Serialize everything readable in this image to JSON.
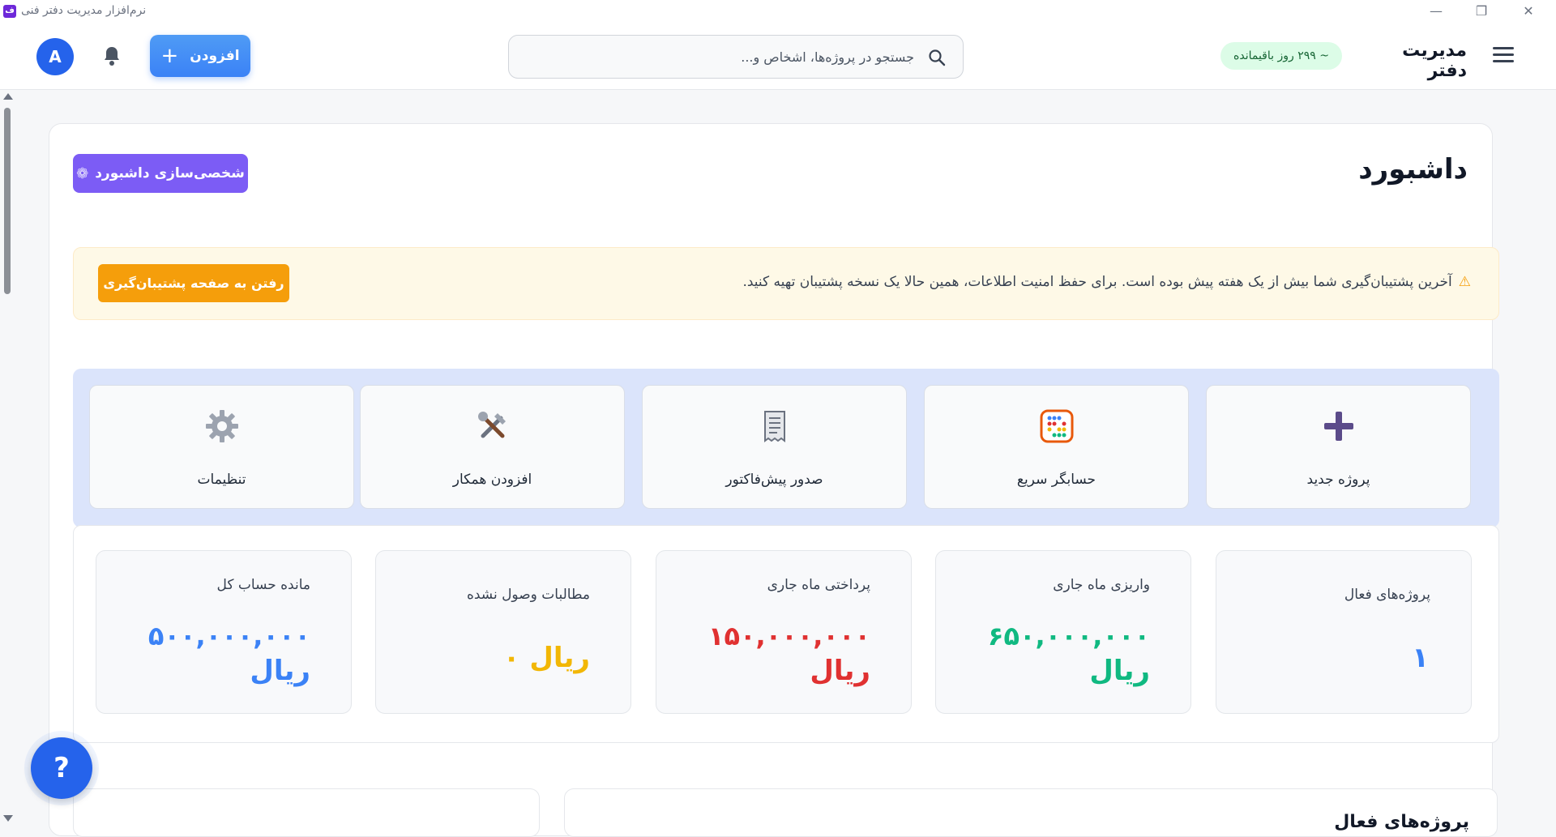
{
  "window": {
    "title": "نرم‌افزار مدیریت دفتر فنی",
    "app_icon_text": "ف",
    "minimize": "—",
    "restore": "❐",
    "close": "✕"
  },
  "header": {
    "brand": "مدیریت دفتر",
    "trial_badge": "~ ۲۹۹ روز باقیمانده",
    "search_placeholder": "جستجو در پروژه‌ها، اشخاص و...",
    "search_value": "",
    "add_label": "افزودن",
    "add_plus": "+",
    "avatar_letter": "A"
  },
  "page": {
    "title": "داشبورد",
    "customize_label": "شخصی‌سازی داشبورد",
    "customize_icon": "❁"
  },
  "alert": {
    "icon": "⚠",
    "text": "آخرین پشتیبان‌گیری شما بیش از یک هفته پیش بوده است. برای حفظ امنیت اطلاعات، همین حالا یک نسخه پشتیبان تهیه کنید.",
    "button_label": "رفتن به صفحه پشتیبان‌گیری"
  },
  "quick_actions": [
    {
      "label": "پروژه جدید",
      "icon": "plus-icon",
      "glyph": "✚",
      "color": "#5b4b8a"
    },
    {
      "label": "حسابگر سریع",
      "icon": "abacus-icon",
      "glyph": "▦",
      "color": "#e8590c"
    },
    {
      "label": "صدور پیش‌فاکتور",
      "icon": "receipt-icon",
      "glyph": "🗎",
      "color": "#6b7280"
    },
    {
      "label": "افزودن همکار",
      "icon": "tools-icon",
      "glyph": "⚒",
      "color": "#7c5a4a"
    },
    {
      "label": "تنظیمات",
      "icon": "gear-icon",
      "glyph": "⚙",
      "color": "#9ca3af"
    }
  ],
  "stats": [
    {
      "label": "پروژه‌های فعال",
      "value": "۱",
      "unit": "",
      "color": "#3b82f6"
    },
    {
      "label": "واریزی ماه جاری",
      "value": "۶۵۰,۰۰۰,۰۰۰",
      "unit": "ریال",
      "color": "#10b981"
    },
    {
      "label": "پرداختی ماه جاری",
      "value": "۱۵۰,۰۰۰,۰۰۰",
      "unit": "ریال",
      "color": "#e03131"
    },
    {
      "label": "مطالبات وصول نشده",
      "value": "ریال ۰",
      "unit": "",
      "color": "#f2b705"
    },
    {
      "label": "مانده حساب کل",
      "value": "۵۰۰,۰۰۰,۰۰۰",
      "unit": "ریال",
      "color": "#3b82f6"
    }
  ],
  "bottom": {
    "right_title": "پروژه‌های فعال"
  },
  "help_label": "?"
}
